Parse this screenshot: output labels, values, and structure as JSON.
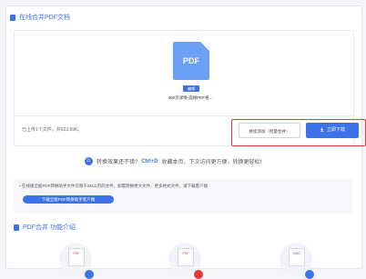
{
  "section": {
    "title": "在线合并PDF文档"
  },
  "file": {
    "thumb_label": "PDF",
    "badge": "编辑",
    "name": "490页详情-选择PDF格..."
  },
  "upload": {
    "status": "已上传1个文件，共623.69K。"
  },
  "actions": {
    "secondary_label": "继续添加（批量合并）",
    "primary_label": "立即下载"
  },
  "feedback": {
    "prefix": "转换效果还不错?",
    "shortcut": "Ctrl+D",
    "suffix": "收藏本页，下次访问更方便，转换更轻松!"
  },
  "notice": {
    "text": "• 在线版全能PDF转换助手文件仅限于2M以内的文件，如需转换更大文件，更多格式文件，请下载客户端",
    "button": "下载全能PDF转换助手客户端"
  },
  "intro": {
    "title": "PDF合并 功能介绍"
  },
  "features": [
    {
      "label": "PDF",
      "accent": "#3d73e8"
    },
    {
      "label": "PDF",
      "accent": "#e53935"
    },
    {
      "label": "DOC",
      "accent": "#3d73e8"
    }
  ],
  "colors": {
    "accent": "#3d73e8",
    "highlight": "#e53935"
  }
}
